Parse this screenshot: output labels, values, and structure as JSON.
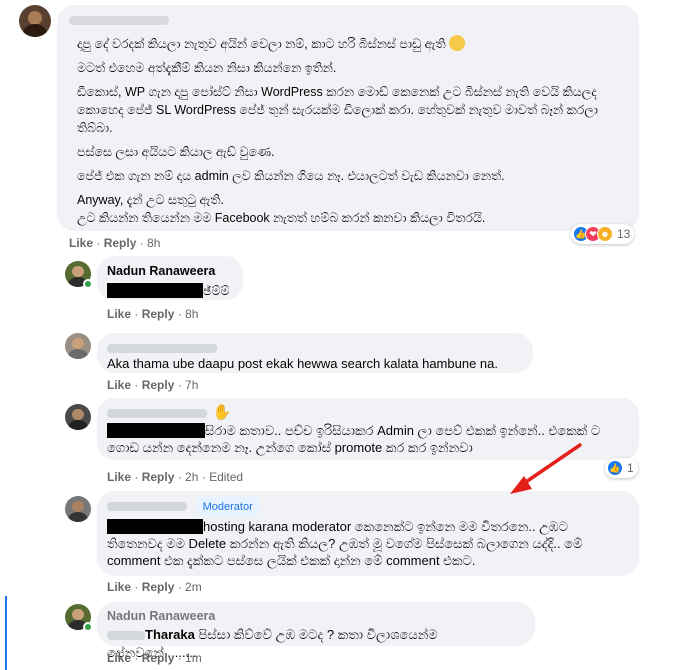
{
  "comments": {
    "c1": {
      "paragraphs": [
        "දාපු දේ වරදක් කියලා නැතුව අයින් වෙලා නම්, කාට හරි බිස්නස් පාඩු ඇති",
        "මටත් එහෙම අත්දැකීම් කියන නිසා කියන්නෙ ඉතින්.",
        "ඩීකොස්, WP ගැන දාපු පෝස්ට් නිසා WordPress කරන මොඩ් කෙනෙක් උට බිස්නස් නැති වෙයි කියලද කොහෙද පේජ් SL WordPress පේජ් තුන් සැරයක්ම ඩිලොක් කරා. හේතුවක් නැතුව මාවත් බෑන් කරලා තිබ්බා.",
        "පස්සෙ ලසා අයියට කියාල ඇඩ් වුණෙ.",
        "පේජ් එක ගැන නම් දාය admin ලව කියන්න ගියෙ නෑ. එයාලටත් වැඩ කියනවා නෙත්.",
        "Anyway, දැන් උට සතුටු ඇති.",
        "උට කියන්න තියෙන්න මම Facebook නැතත් හම්බ කරන් කනවා කියලා විතරයි."
      ],
      "like": "Like",
      "reply": "Reply",
      "time": "8h",
      "reaction_count": "13"
    },
    "c2": {
      "name": "Nadun Ranaweera",
      "text_suffix": "ඡ්ම්ම්",
      "like": "Like",
      "reply": "Reply",
      "time": "8h"
    },
    "c3": {
      "text": "Aka thama ube daapu post ekak hewwa search kalata hambune na.",
      "like": "Like",
      "reply": "Reply",
      "time": "7h"
    },
    "c4": {
      "text_line1": "සිරාම කතාව.. පච්ච ඉරිසියාකර Admin ලා පෙව් එකක් ඉන්නේ.. එකෙක් ට",
      "text_line2": "ගොඩ යන්න දෙන්නෙම නෑ. උන්ගෙ කෝස් promote කර කර ඉන්නවා",
      "like": "Like",
      "reply": "Reply",
      "time": "2h",
      "edited": "Edited",
      "reaction_count": "1"
    },
    "c5": {
      "badge": "Moderator",
      "text_line1": "hosting karana moderator කෙනෙක්ට ඉන්නෙ මම විතරනෙ.. උඹට",
      "text_line2": "තිතෙනවද මම Delete කරන්න ඇති කියල? උඹත් මූ වගේම පිස්සෙක් බලාගෙන යද්දි.. මේ",
      "text_line3": "comment එක දැක්කට පස්සෙ ලයික් එකක් දාන්න මේ comment එකට.",
      "like": "Like",
      "reply": "Reply",
      "time": "2m"
    },
    "c6": {
      "name": "Nadun Ranaweera",
      "mention": "Tharaka",
      "text": " පිස්සා කිව්වේ උඹ මටද ? කතා විලාශයෙන්ම පේනවනේ.........",
      "like": "Like",
      "reply": "Reply",
      "time": "1m"
    }
  },
  "colors": {
    "bubble": "#f0f2f5",
    "meta": "#65676b",
    "like_blue": "#1877f2",
    "love_red": "#f33e58",
    "care_yellow": "#f7b125",
    "online": "#31a24c",
    "arrow": "#e5201a"
  },
  "icons": [
    "like-reaction-icon",
    "love-reaction-icon",
    "care-reaction-icon",
    "waving-hand-icon",
    "smiling-face-icon"
  ]
}
